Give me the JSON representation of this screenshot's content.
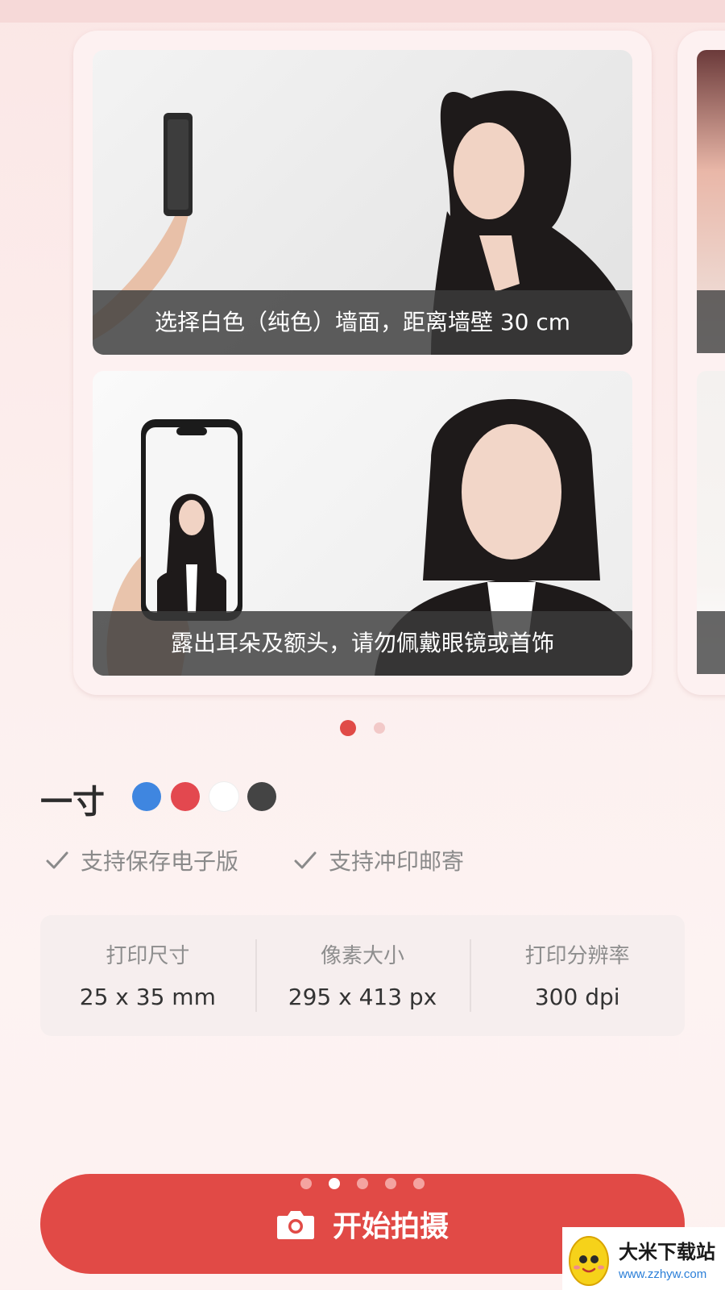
{
  "carousel": {
    "captions": [
      "选择白色（纯色）墙面，距离墙壁 30 cm",
      "露出耳朵及额头，请勿佩戴眼镜或首饰"
    ],
    "page_count": 2,
    "active_page": 1
  },
  "product": {
    "size_name": "一寸",
    "background_colors": [
      {
        "name": "blue",
        "hex": "#3f86e0"
      },
      {
        "name": "red",
        "hex": "#e3484f"
      },
      {
        "name": "white",
        "hex": "#ffffff"
      },
      {
        "name": "dark-gray",
        "hex": "#444444"
      }
    ],
    "features": [
      "支持保存电子版",
      "支持冲印邮寄"
    ]
  },
  "specs": [
    {
      "label": "打印尺寸",
      "value": "25 x 35 mm"
    },
    {
      "label": "像素大小",
      "value": "295 x 413 px"
    },
    {
      "label": "打印分辨率",
      "value": "300 dpi"
    }
  ],
  "action": {
    "shoot_label": "开始拍摄",
    "icon": "camera-icon",
    "pager_count": 5,
    "pager_active": 2
  },
  "watermark": {
    "title": "大米下载站",
    "url": "www.zzhyw.com"
  },
  "colors": {
    "accent": "#e14a46"
  }
}
